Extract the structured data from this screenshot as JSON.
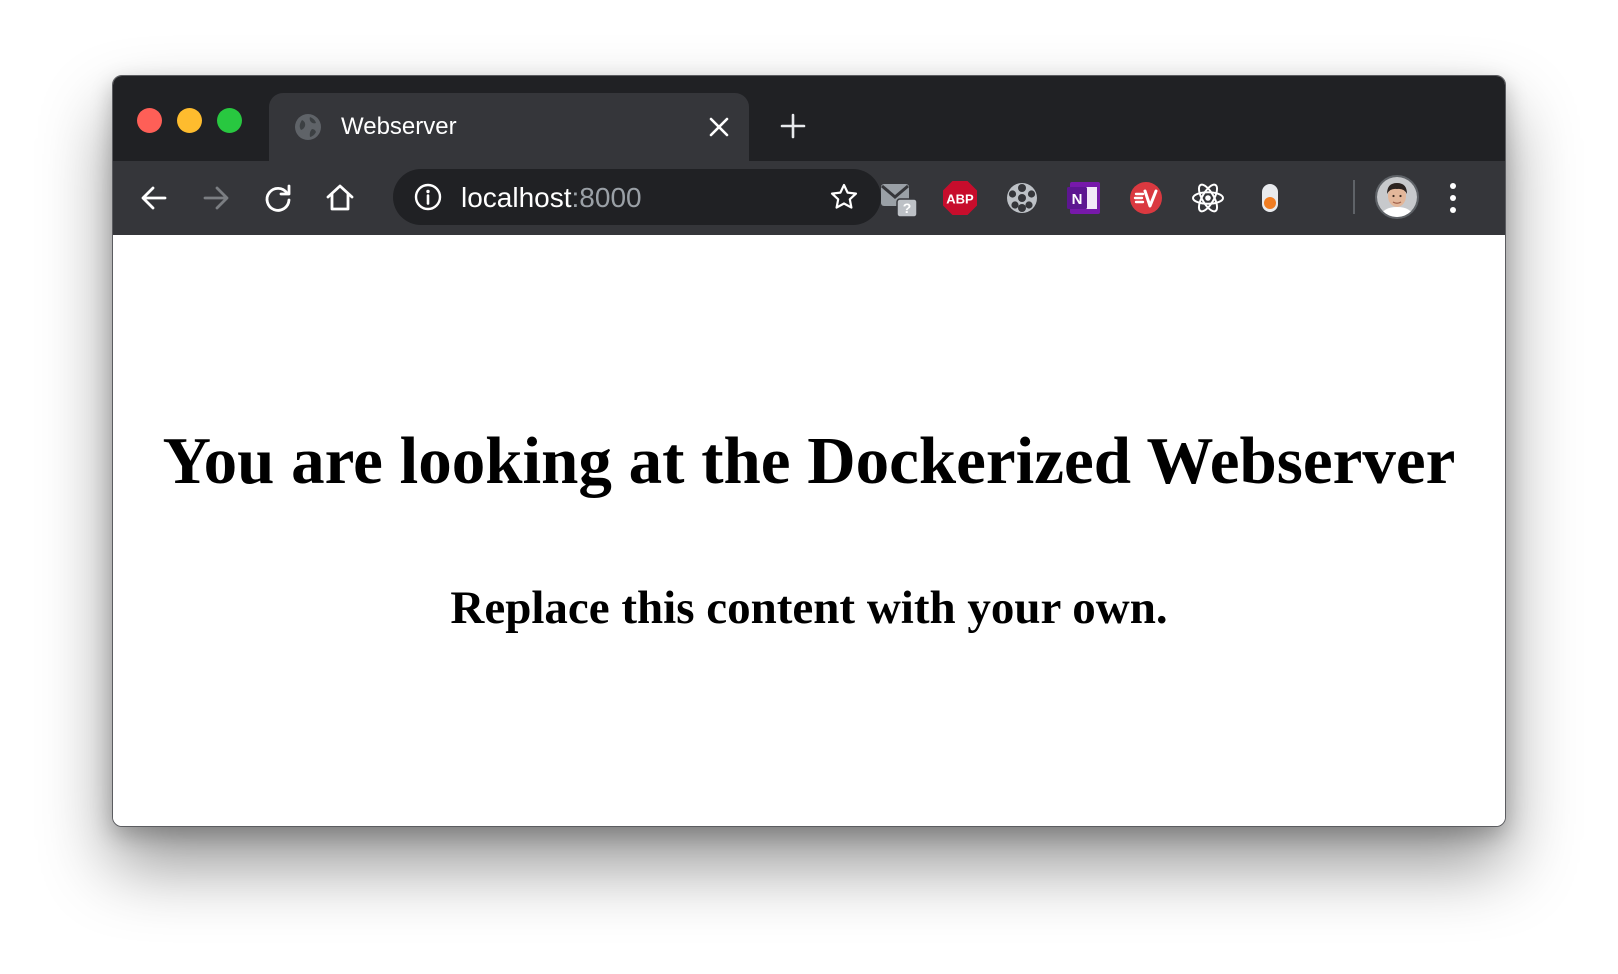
{
  "browser": {
    "tab": {
      "title": "Webserver"
    },
    "address_bar": {
      "host": "localhost",
      "port": ":8000"
    },
    "extensions": [
      {
        "name": "mail-checker-icon",
        "badge": "?"
      },
      {
        "name": "adblock-plus-icon",
        "label": "ABP"
      },
      {
        "name": "film-reel-icon"
      },
      {
        "name": "onenote-clipper-icon",
        "label": "N"
      },
      {
        "name": "expressvpn-icon"
      },
      {
        "name": "react-devtools-icon"
      },
      {
        "name": "toggle-extension-icon"
      }
    ]
  },
  "page": {
    "heading": "You are looking at the Dockerized Webserver",
    "subheading": "Replace this content with your own."
  },
  "colors": {
    "titlebar": "#202124",
    "toolbar": "#35363a",
    "traffic_close": "#fe5f57",
    "traffic_minimize": "#febc2e",
    "traffic_maximize": "#28c840",
    "abp_red": "#c70d2c",
    "onenote_purple": "#7719aa",
    "expressvpn_red": "#da3940"
  }
}
